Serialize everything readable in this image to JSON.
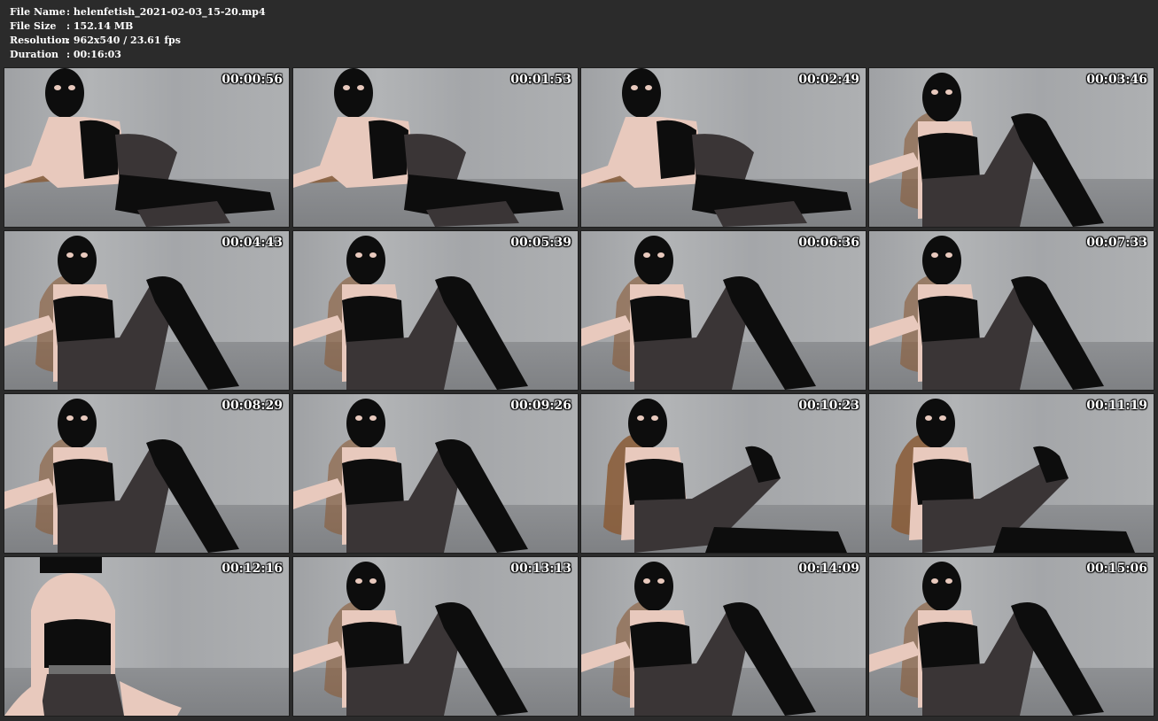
{
  "info": {
    "rows": [
      {
        "key": "File Name",
        "value": ": helenfetish_2021-02-03_15-20.mp4"
      },
      {
        "key": "File Size",
        "value": ": 152.14 MB"
      },
      {
        "key": "Resolution",
        "value": ": 962x540 / 23.61 fps"
      },
      {
        "key": "Duration",
        "value": ": 00:16:03"
      }
    ]
  },
  "thumbnails": [
    {
      "time": "00:00:56",
      "pose": "reclined"
    },
    {
      "time": "00:01:53",
      "pose": "reclined"
    },
    {
      "time": "00:02:49",
      "pose": "reclined"
    },
    {
      "time": "00:03:46",
      "pose": "seated"
    },
    {
      "time": "00:04:43",
      "pose": "seated"
    },
    {
      "time": "00:05:39",
      "pose": "seated"
    },
    {
      "time": "00:06:36",
      "pose": "seated"
    },
    {
      "time": "00:07:33",
      "pose": "seated"
    },
    {
      "time": "00:08:29",
      "pose": "seated"
    },
    {
      "time": "00:09:26",
      "pose": "seated"
    },
    {
      "time": "00:10:23",
      "pose": "seated-legs-out"
    },
    {
      "time": "00:11:19",
      "pose": "seated-legs-out"
    },
    {
      "time": "00:12:16",
      "pose": "closeup"
    },
    {
      "time": "00:13:13",
      "pose": "seated"
    },
    {
      "time": "00:14:09",
      "pose": "seated"
    },
    {
      "time": "00:15:06",
      "pose": "seated"
    }
  ],
  "colors": {
    "background": "#2b2b2b",
    "text": "#ffffff",
    "latex": "#0d0d0d",
    "skin": "#e8c9bd",
    "hair": "#8a5a35",
    "nylon": "#3a3536"
  }
}
